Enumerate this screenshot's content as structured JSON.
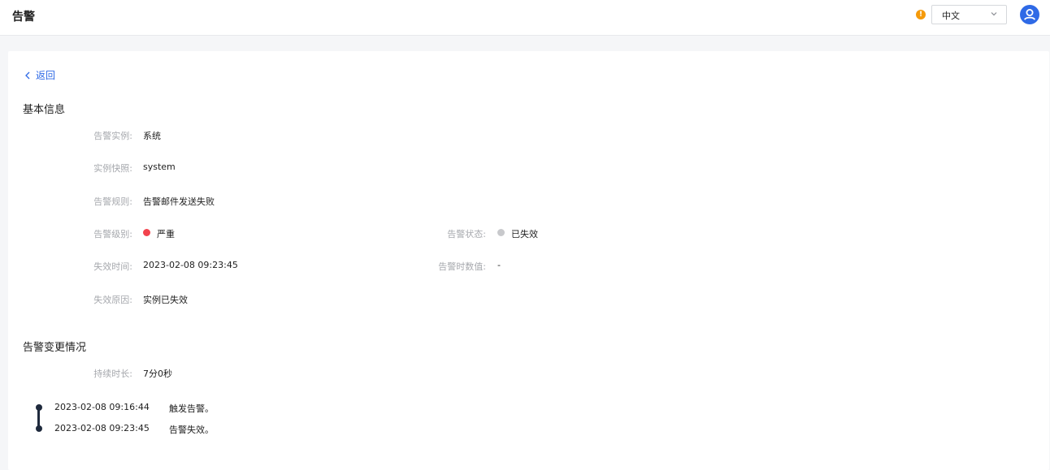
{
  "header": {
    "title": "告警",
    "language": "中文"
  },
  "back_label": "返回",
  "basic_info": {
    "title": "基本信息",
    "instance_label": "告警实例:",
    "instance_value": "系统",
    "snapshot_label": "实例快照:",
    "snapshot_value": "system",
    "rule_label": "告警规则:",
    "rule_value": "告警邮件发送失败",
    "level_label": "告警级别:",
    "level_value": "严重",
    "status_label": "告警状态:",
    "status_value": "已失效",
    "expire_time_label": "失效时间:",
    "expire_time_value": "2023-02-08 09:23:45",
    "alert_value_label": "告警时数值:",
    "alert_value_value": "-",
    "expire_reason_label": "失效原因:",
    "expire_reason_value": "实例已失效"
  },
  "changes": {
    "title": "告警变更情况",
    "duration_label": "持续时长:",
    "duration_value": "7分0秒",
    "timeline": [
      {
        "time": "2023-02-08 09:16:44",
        "event": "触发告警。"
      },
      {
        "time": "2023-02-08 09:23:45",
        "event": "告警失效。"
      }
    ]
  },
  "colors": {
    "accent": "#2f6ae6",
    "severity_critical": "#f2434d",
    "status_expired": "#c8c9cc",
    "warning": "#f59a0a"
  },
  "icons": {
    "warning": "exclamation-circle-icon",
    "dropdown": "chevron-down-icon",
    "user": "user-avatar-icon",
    "back": "chevron-left-icon"
  }
}
